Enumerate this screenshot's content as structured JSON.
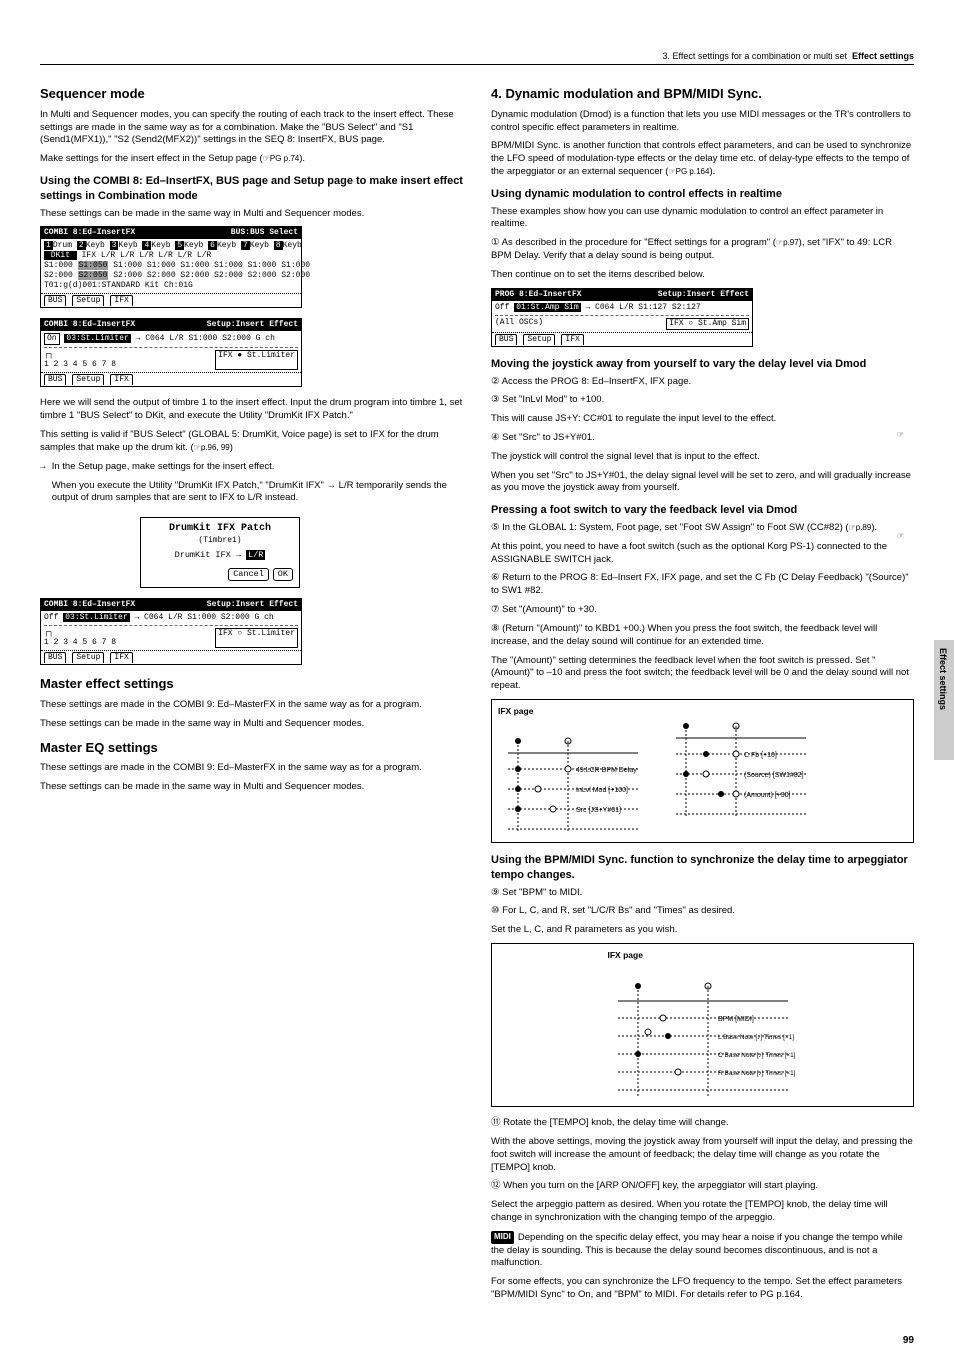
{
  "header": {
    "right_light": "3. Effect settings for a combination or multi set",
    "right_bold": "Effect settings"
  },
  "left": {
    "sec1_h3": "Sequencer mode",
    "sec1_p1": "In Multi and Sequencer modes, you can specify the routing of each track to the insert effect. These settings are made in the same way as for a combination. Make the \"BUS Select\" and \"S1 (Send1(MFX1)),\" \"S2 (Send2(MFX2))\" settings in the SEQ 8: InsertFX, BUS page.",
    "sec1_p2_a": "Make settings for the insert effect in the Setup page (",
    "sec1_p2_ref": "☞PG p.74",
    "sec1_p2_b": ").",
    "sec2_h4": "Using the COMBI 8: Ed–InsertFX, BUS page and Setup page to make insert effect settings in Combination mode",
    "sec2_p1": "These settings can be made in the same way in Multi and Sequencer modes.",
    "lcd1": {
      "title_l": "COMBI 8:Ed–InsertFX",
      "title_r": "BUS:BUS Select",
      "heads": [
        "1",
        "Drum",
        "2",
        "Keyb",
        "3",
        "Keyb",
        "4",
        "Keyb",
        "5",
        "Keyb",
        "6",
        "Keyb",
        "7",
        "Keyb",
        "8",
        "Keyb"
      ],
      "row_bus": "DKit   IFX   L/R   L/R   L/R   L/R   L/R   L/R",
      "row_s1": "S1:000 S1:050 S1:000 S1:000 S1:000 S1:000 S1:000 S1:000",
      "row_s2": "S2:000 S2:050 S2:000 S2:000 S2:000 S2:000 S2:000 S2:000",
      "row_info": "T01:g(d)001:STANDARD Kit                    Ch:01G",
      "tab1": "BUS",
      "tab2": "Setup",
      "tab3": "IFX"
    },
    "lcd2": {
      "title_l": "COMBI 8:Ed–InsertFX",
      "title_r": "Setup:Insert Effect",
      "row1_on": "On",
      "row1_sel": "03:St.Limiter",
      "row1_rest": "→ C064 L/R S1:000 S2:000  G ch",
      "row_routing": "1 2 3 4 5 6 7 8",
      "row_ifx": "IFX ● St.Limiter",
      "tab1": "BUS",
      "tab2": "Setup",
      "tab3": "IFX"
    },
    "sec3_p1": "Here we will send the output of timbre 1 to the insert effect. Input the drum program into timbre 1, set timbre 1 \"BUS Select\" to DKit, and execute the Utility \"DrumKit IFX Patch.\"",
    "sec3_note_a": "This setting is valid if \"BUS Select\" (GLOBAL 5: DrumKit, Voice page) is set to IFX for the drum samples that make up the drum kit. (",
    "sec3_note_ref": "☞p.96, 99",
    "sec3_note_b": ")",
    "arrow_line1": "In the Setup page, make settings for the insert effect.",
    "arrow_line2_a": "When you execute the Utility \"DrumKit IFX Patch,\" \"DrumKit IFX\" ",
    "arrow_line2_b": " L/R temporarily sends the output of drum samples that are sent to IFX to L/R instead.",
    "dialog": {
      "title": "DrumKit IFX Patch",
      "sub": "(Timbre1)",
      "line": "DrumKit IFX →",
      "sel": "L/R",
      "cancel": "Cancel",
      "ok": "OK"
    },
    "lcd3": {
      "title_l": "COMBI 8:Ed–InsertFX",
      "title_r": "Setup:Insert Effect",
      "row1_off": "Off",
      "row1_sel": "03:St.Limiter",
      "row1_rest": "→ C064 L/R S1:000 S2:000  G ch",
      "row_routing": "1 2 3 4 5 6 7 8",
      "row_ifx": "IFX ○ St.Limiter",
      "tab1": "BUS",
      "tab2": "Setup",
      "tab3": "IFX"
    },
    "sec4_h3": "Master effect settings",
    "sec4_p1": "These settings are made in the COMBI 9: Ed–MasterFX in the same way as for a program.",
    "sec4_p2": "These settings can be made in the same way in Multi and Sequencer modes.",
    "sec5_h3": "Master EQ settings",
    "sec5_p1": "These settings are made in the COMBI 9: Ed–MasterFX in the same way as for a program.",
    "sec5_p2": "These settings can be made in the same way in Multi and Sequencer modes."
  },
  "right": {
    "h3_1": "4. Dynamic modulation and BPM/MIDI Sync.",
    "p1": "Dynamic modulation (Dmod) is a function that lets you use MIDI messages or the TR's controllers to control specific effect parameters in realtime.",
    "p2_a": "BPM/MIDI Sync. is another function that controls effect parameters, and can be used to synchronize the LFO speed of modulation-type effects or the delay time etc. of delay-type effects to the tempo of the arpeggiator or an external sequencer (",
    "p2_ref": "☞PG p.164",
    "p2_b": ").",
    "h4_1": "Using dynamic modulation to control effects in realtime",
    "p3": "These examples show how you can use dynamic modulation to control an effect parameter in realtime.",
    "step1_a": "① As described in the procedure for \"Effect settings for a program\" (",
    "step1_ref": "☞p.97",
    "step1_b": "), set \"IFX\" to 49: LCR BPM Delay. Verify that a delay sound is being output.",
    "step1_c": "Then continue on to set the items described below.",
    "lcd4": {
      "title_l": "PROG 8:Ed–InsertFX",
      "title_r": "Setup:Insert Effect",
      "row1_off": "Off",
      "row1_sel": "01:St.Amp Sim",
      "row1_rest": "→ C064 L/R S1:127 S2:127",
      "all": "(All OSCs)",
      "row_ifx": "IFX ○ St.Amp Sim",
      "tab1": "BUS",
      "tab2": "Setup",
      "tab3": "IFX"
    },
    "h4_2": "Moving the joystick away from yourself to vary the delay level via Dmod",
    "step2": "② Access the PROG 8: Ed–InsertFX, IFX page.",
    "step3_a": "③ Set \"InLvl Mod\" to +100.",
    "step3_b": "This will cause JS+Y: CC#01 to regulate the input level to the effect.",
    "step4_a": "④ Set \"Src\" to JS+Y#01.",
    "step4_b": "The joystick will control the signal level that is input to the effect.",
    "step4_c": "When you set \"Src\" to JS+Y#01, the delay signal level will be set to zero, and will gradually increase as you move the joystick away from yourself.",
    "h4_3": "Pressing a foot switch to vary the feedback level via Dmod",
    "step5_a": "⑤ In the GLOBAL 1: System, Foot page, set \"Foot SW Assign\" to Foot SW (CC#82) (",
    "step5_ref": "☞p.89",
    "step5_b": ").",
    "step5_c": "At this point, you need to have a foot switch (such as the optional Korg PS-1) connected to the ASSIGNABLE SWITCH jack.",
    "step6": "⑥ Return to the PROG 8: Ed–Insert FX, IFX page, and set the C Fb (C Delay Feedback) \"(Source)\" to SW1 #82.",
    "step7_a": "⑦ Set \"(Amount)\" to +30.",
    "step8_a": "⑧ (Return \"(Amount)\" to KBD1 +00.) When you press the foot switch, the feedback level will increase, and the delay sound will continue for an extended time.",
    "step8_b": "The \"(Amount)\" setting determines the feedback level when the foot switch is pressed. Set \"(Amount)\" to –10 and press the foot switch; the feedback level will be 0 and the delay sound will not repeat.",
    "diagram1": {
      "left_title": "IFX page",
      "left_items": [
        "49:LCR BPM Delay",
        "InLvl Mod [+100]",
        "Src [JS+Y#01]"
      ],
      "right_items": [
        "C Fb [+10]",
        "(Source) [SW1#82]",
        "(Amount) [+30]"
      ]
    },
    "h4_4": "Using the BPM/MIDI Sync. function to synchronize the delay time to arpeggiator tempo changes.",
    "step9": "⑨ Set \"BPM\" to MIDI.",
    "step10_a": "⑩ For L, C, and R, set \"L/C/R Bs\" and \"Times\" as desired.",
    "step10_b": "Set the L, C, and R parameters as you wish.",
    "diagram2": {
      "title": "IFX page",
      "items": [
        "BPM [MIDI]",
        "L Base Note [♪]  Times [×1]",
        "C Base Note [♪]  Times [×1]",
        "R Base Note [♪]  Times [×1]"
      ]
    },
    "step11_a": "⑪ Rotate the [TEMPO] knob, the delay time will change.",
    "step11_b": "With the above settings, moving the joystick away from yourself will input the delay, and pressing the foot switch will increase the amount of feedback; the delay time will change as you rotate the [TEMPO] knob.",
    "step12_a": "⑫ When you turn on the [ARP ON/OFF] key, the arpeggiator will start playing.",
    "step12_b": "Select the arpeggio pattern as desired. When you rotate the [TEMPO] knob, the delay time will change in synchronization with the changing tempo of the arpeggio.",
    "midi_note": "Depending on the specific delay effect, you may hear a noise if you change the tempo while the delay is sounding. This is because the delay sound becomes discontinuous, and is not a malfunction.",
    "final_note_a": "For some effects, you can synchronize the LFO frequency to the tempo. Set the effect parameters \"BPM/MIDI Sync\" to On, and \"BPM\" to MIDI. For details refer to PG p.164."
  },
  "page_num": "99",
  "side": "Effect settings"
}
